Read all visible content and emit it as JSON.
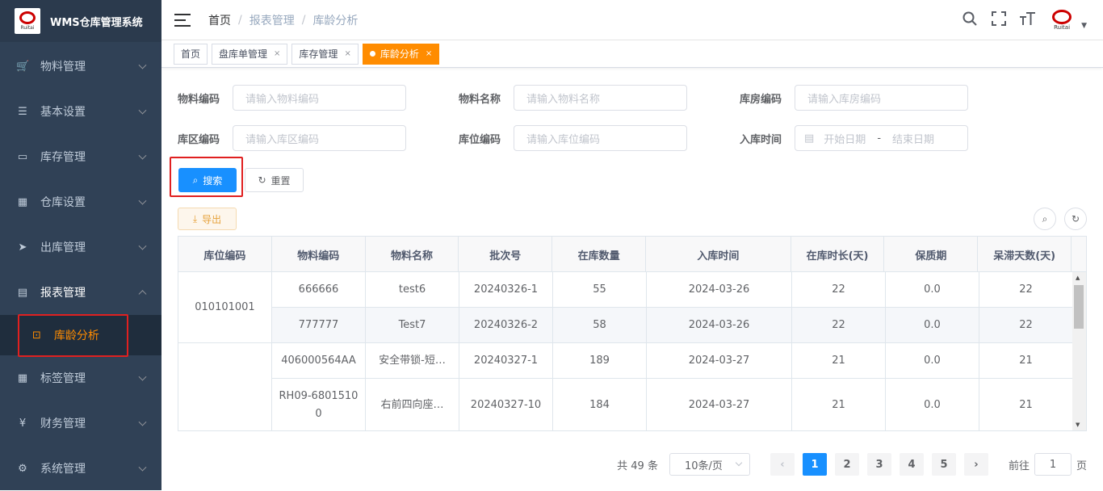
{
  "app": {
    "title": "WMS仓库管理系统",
    "logo_text": "Ruitai"
  },
  "sidebar": {
    "items": [
      {
        "label": "物料管理",
        "icon": "cart-icon"
      },
      {
        "label": "基本设置",
        "icon": "sliders-icon"
      },
      {
        "label": "库存管理",
        "icon": "monitor-icon"
      },
      {
        "label": "仓库设置",
        "icon": "grid-icon"
      },
      {
        "label": "出库管理",
        "icon": "send-icon"
      },
      {
        "label": "报表管理",
        "icon": "report-icon"
      },
      {
        "label": "库龄分析",
        "icon": "chart-icon"
      },
      {
        "label": "标签管理",
        "icon": "grid-icon"
      },
      {
        "label": "财务管理",
        "icon": "yen-icon"
      },
      {
        "label": "系统管理",
        "icon": "gear-icon"
      }
    ]
  },
  "breadcrumb": [
    "首页",
    "报表管理",
    "库龄分析"
  ],
  "tabs": [
    {
      "label": "首页"
    },
    {
      "label": "盘库单管理",
      "close": "×"
    },
    {
      "label": "库存管理",
      "close": "×"
    },
    {
      "label": "库龄分析",
      "close": "×"
    }
  ],
  "form": {
    "material_code": {
      "label": "物料编码",
      "placeholder": "请输入物料编码"
    },
    "material_name": {
      "label": "物料名称",
      "placeholder": "请输入物料名称"
    },
    "warehouse_code": {
      "label": "库房编码",
      "placeholder": "请输入库房编码"
    },
    "area_code": {
      "label": "库区编码",
      "placeholder": "请输入库区编码"
    },
    "location_code": {
      "label": "库位编码",
      "placeholder": "请输入库位编码"
    },
    "in_time": {
      "label": "入库时间",
      "start": "开始日期",
      "sep": "-",
      "end": "结束日期"
    }
  },
  "buttons": {
    "search": "搜索",
    "reset": "重置",
    "export": "导出"
  },
  "table": {
    "columns": [
      "库位编码",
      "物料编码",
      "物料名称",
      "批次号",
      "在库数量",
      "入库时间",
      "在库时长(天)",
      "保质期",
      "呆滞天数(天)"
    ],
    "groups": [
      {
        "location": "010101001"
      },
      {
        "location": ""
      }
    ],
    "rows": [
      {
        "material_code": "666666",
        "material_name": "test6",
        "batch": "20240326-1",
        "qty": "55",
        "in_time": "2024-03-26",
        "days": "22",
        "shelf": "0.0",
        "idle": "22"
      },
      {
        "material_code": "777777",
        "material_name": "Test7",
        "batch": "20240326-2",
        "qty": "58",
        "in_time": "2024-03-26",
        "days": "22",
        "shelf": "0.0",
        "idle": "22"
      },
      {
        "material_code": "406000564AA",
        "material_name": "安全带锁-短…",
        "batch": "20240327-1",
        "qty": "189",
        "in_time": "2024-03-27",
        "days": "21",
        "shelf": "0.0",
        "idle": "21"
      },
      {
        "material_code": "RH09-68015100",
        "material_name": "右前四向座…",
        "batch": "20240327-10",
        "qty": "184",
        "in_time": "2024-03-27",
        "days": "21",
        "shelf": "0.0",
        "idle": "21"
      }
    ]
  },
  "pagination": {
    "total": "共 49 条",
    "size": "10条/页",
    "pages": [
      "1",
      "2",
      "3",
      "4",
      "5"
    ],
    "goto": "前往",
    "goto_value": "1",
    "page_unit": "页"
  }
}
